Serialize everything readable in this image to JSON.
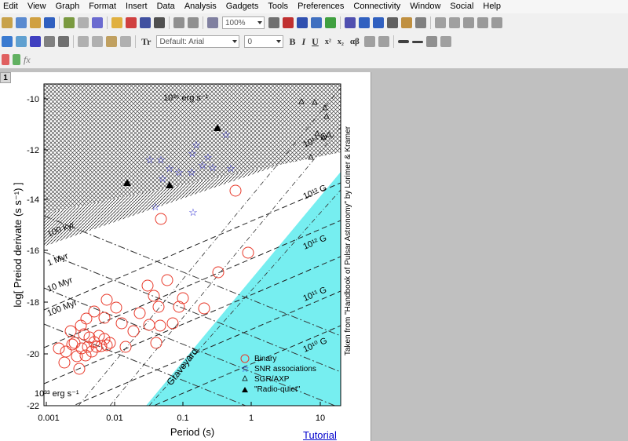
{
  "menu": [
    "Edit",
    "View",
    "Graph",
    "Format",
    "Insert",
    "Data",
    "Analysis",
    "Gadgets",
    "Tools",
    "Preferences",
    "Connectivity",
    "Window",
    "Social",
    "Help"
  ],
  "toolbar": {
    "zoom_value": "100%",
    "font_value": "Default: Arial",
    "font_size_value": "0",
    "font_icon": "Tr",
    "sub_label": "x²",
    "sub2_label": "x₂",
    "greek_label": "αβ",
    "fx_label": "fx"
  },
  "window": {
    "page_number": "1"
  },
  "graph": {
    "ylabel": "log[ Preiod derivate (s s⁻¹) ]",
    "xlabel": "Period (s)",
    "side_note": "Taken from \"Handbook of Pulsar Astronomy\" by Lorimer & Kramer",
    "yticks": [
      "-10",
      "-12",
      "-14",
      "-16",
      "-18",
      "-20",
      "-22"
    ],
    "xticks": [
      "0.001",
      "0.01",
      "0.1",
      "1",
      "10"
    ],
    "age_labels": [
      "100 kyr",
      "1 Myr",
      "10 Myr",
      "100 Myr"
    ],
    "field_labels": [
      "10¹⁴ G",
      "10¹³ G",
      "10¹² G",
      "10¹¹ G",
      "10¹⁰ G"
    ],
    "edot_top": "10³⁶ erg s⁻¹",
    "edot_bottom": "10³³ erg s⁻¹",
    "graveyard": "Graveyard",
    "legend": [
      "Binary",
      "SNR associations",
      "SGR/AXP",
      "\"Radio-quiet\""
    ],
    "colors": {
      "cyan": "#76eef0",
      "binary": "#e8392a",
      "snr": "#2020d0",
      "black": "#000000"
    }
  },
  "tutorial": "Tutorial"
}
